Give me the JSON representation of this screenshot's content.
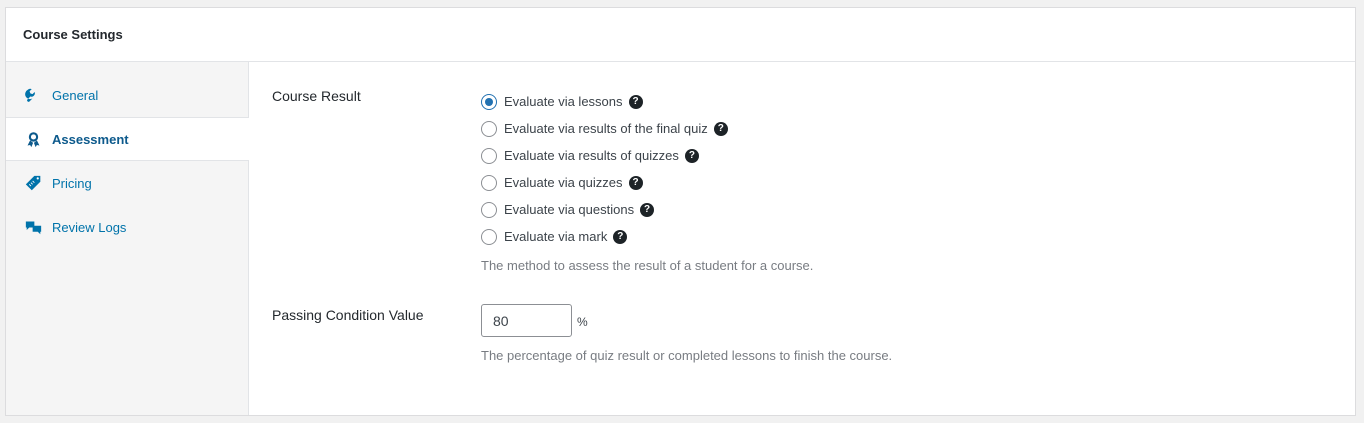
{
  "panel": {
    "title": "Course Settings"
  },
  "tabs": [
    {
      "label": "General",
      "icon": "wrench-icon"
    },
    {
      "label": "Assessment",
      "icon": "award-icon"
    },
    {
      "label": "Pricing",
      "icon": "price-tag-icon"
    },
    {
      "label": "Review Logs",
      "icon": "chat-bubbles-icon"
    }
  ],
  "course_result": {
    "label": "Course Result",
    "options": [
      {
        "label": "Evaluate via lessons",
        "checked": true
      },
      {
        "label": "Evaluate via results of the final quiz",
        "checked": false
      },
      {
        "label": "Evaluate via results of quizzes",
        "checked": false
      },
      {
        "label": "Evaluate via quizzes",
        "checked": false
      },
      {
        "label": "Evaluate via questions",
        "checked": false
      },
      {
        "label": "Evaluate via mark",
        "checked": false
      }
    ],
    "help_glyph": "?",
    "description": "The method to assess the result of a student for a course."
  },
  "passing_condition": {
    "label": "Passing Condition Value",
    "value": "80",
    "unit": "%",
    "description": "The percentage of quiz result or completed lessons to finish the course."
  },
  "colors": {
    "accent": "#2271b1",
    "link": "#0073aa",
    "active_tab": "#0d5a8c"
  }
}
